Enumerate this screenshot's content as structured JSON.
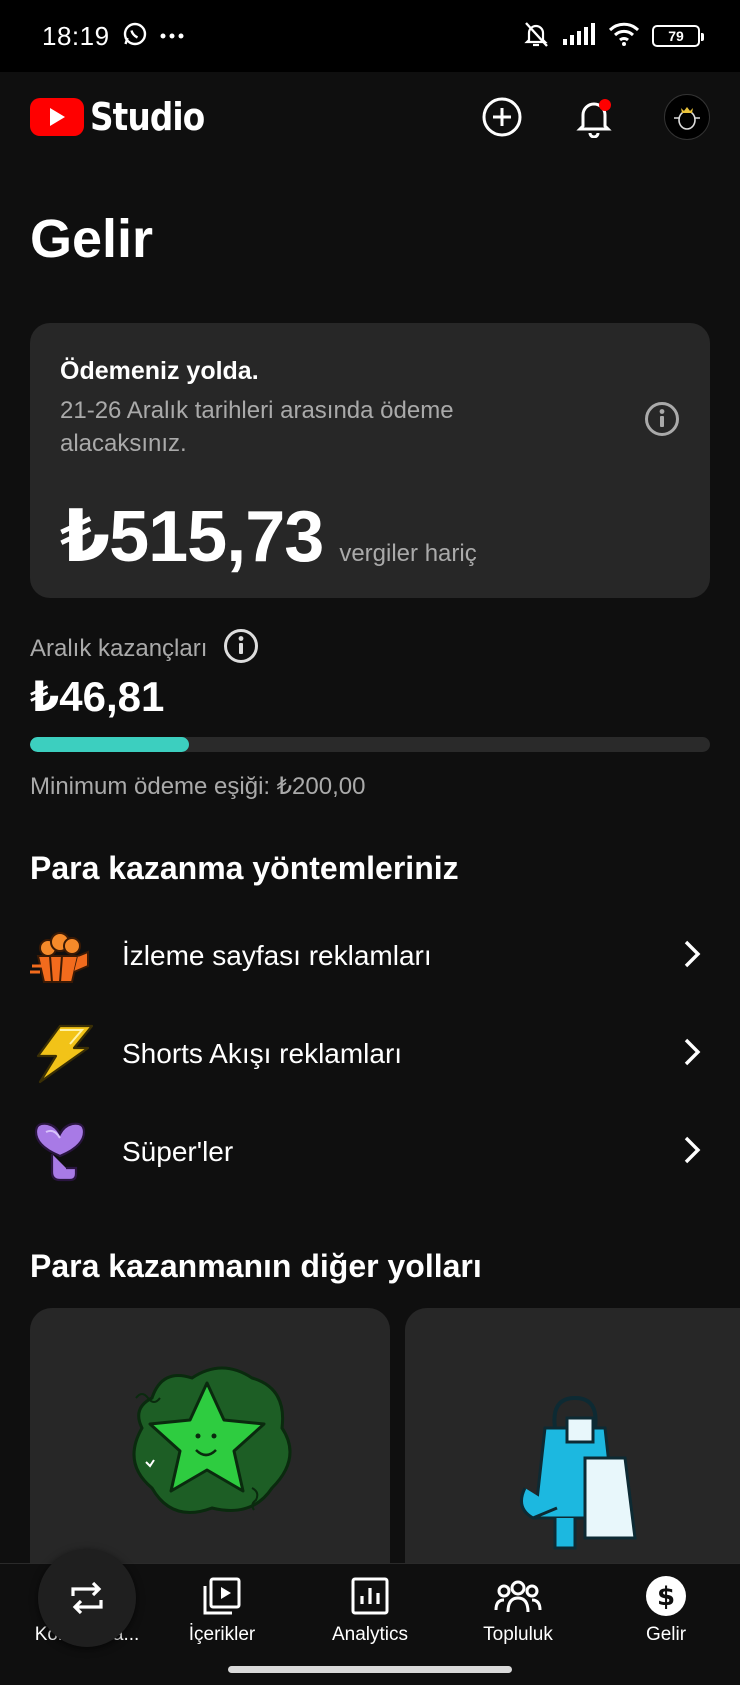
{
  "status_bar": {
    "time": "18:19",
    "battery": "79",
    "icons": [
      "whatsapp-icon",
      "more-icon",
      "mute-icon",
      "signal-icon",
      "wifi-icon",
      "battery-icon"
    ]
  },
  "app_bar": {
    "logo_text": "Studio",
    "icons": [
      "create-icon",
      "notification-icon",
      "avatar"
    ],
    "colors": {
      "brand": "#ff0000",
      "notification_dot": "#ff0000"
    }
  },
  "page": {
    "title": "Gelir"
  },
  "payout_card": {
    "title": "Ödemeniz yolda.",
    "description": "21-26 Aralık tarihleri arasında ödeme alacaksınız.",
    "amount": "₺515,73",
    "amount_note": "vergiler hariç"
  },
  "earnings": {
    "label": "Aralık kazançları",
    "value": "₺46,81",
    "progress_fraction": 0.234,
    "threshold_text": "Minimum ödeme eşiği: ₺200,00",
    "colors": {
      "progress": "#3ccfbf"
    }
  },
  "methods": {
    "title": "Para kazanma yöntemleriniz",
    "items": [
      {
        "label": "İzleme sayfası reklamları",
        "icon": "popcorn-icon"
      },
      {
        "label": "Shorts Akışı reklamları",
        "icon": "lightning-icon"
      },
      {
        "label": "Süper'ler",
        "icon": "super-thanks-icon"
      }
    ]
  },
  "other_ways": {
    "title": "Para kazanmanın diğer yolları",
    "cards": [
      {
        "icon": "star-icon"
      },
      {
        "icon": "shopping-icon"
      }
    ]
  },
  "bottom_nav": {
    "items": [
      {
        "label": "Kontrol Pa...",
        "icon": "dashboard-icon"
      },
      {
        "label": "İçerikler",
        "icon": "content-icon"
      },
      {
        "label": "Analytics",
        "icon": "analytics-icon"
      },
      {
        "label": "Topluluk",
        "icon": "community-icon"
      },
      {
        "label": "Gelir",
        "icon": "earn-icon"
      }
    ]
  }
}
